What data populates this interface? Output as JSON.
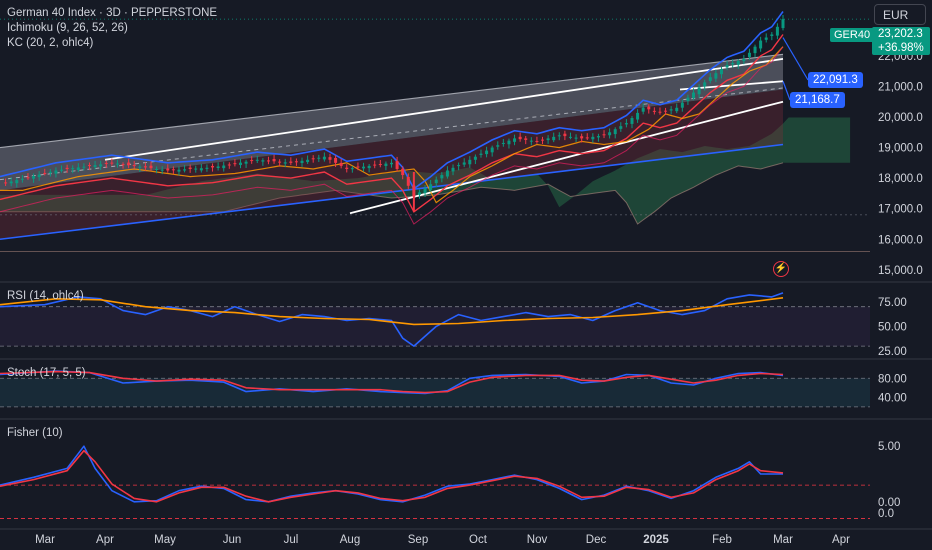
{
  "header": {
    "title": "German 40 Index · 3D · PEPPERSTONE",
    "indicators": [
      "Ichimoku (9, 26, 52, 26)",
      "KC (20, 2, ohlc4)"
    ]
  },
  "currency": "EUR",
  "price_tags": {
    "symbol": "GER40",
    "last_price": "23,202.3",
    "change_pct": "+36.98%",
    "level_upper": "22,091.3",
    "level_lower": "21,168.7"
  },
  "colors": {
    "bg": "#161a25",
    "up": "#089981",
    "down": "#f23645",
    "blue": "#2962ff",
    "orange": "#ff9800",
    "rsi": "#2962ff",
    "grid": "#2a2e39",
    "text": "#d1d4dc"
  },
  "chart_data": [
    {
      "type": "candlestick",
      "name": "main",
      "x_labels": [
        "Mar",
        "Apr",
        "May",
        "Jun",
        "Jul",
        "Aug",
        "Sep",
        "Oct",
        "Nov",
        "Dec",
        "2025",
        "Feb",
        "Mar",
        "Apr"
      ],
      "y_ticks": [
        15000,
        16000,
        17000,
        18000,
        19000,
        20000,
        21000,
        22000
      ],
      "y_tick_labels": [
        "15,000.0",
        "16,000.0",
        "17,000.0",
        "18,000.0",
        "19,000.0",
        "20,000.0",
        "21,000.0",
        "22,000.0"
      ],
      "ylim": [
        14700,
        23500
      ],
      "close_path": [
        [
          0,
          17800
        ],
        [
          10,
          18250
        ],
        [
          20,
          18500
        ],
        [
          30,
          18250
        ],
        [
          38,
          18350
        ],
        [
          46,
          18600
        ],
        [
          52,
          18500
        ],
        [
          58,
          18700
        ],
        [
          62,
          18300
        ],
        [
          66,
          18400
        ],
        [
          70,
          18500
        ],
        [
          72,
          18100
        ],
        [
          74,
          17400
        ],
        [
          77,
          17800
        ],
        [
          80,
          18250
        ],
        [
          84,
          18600
        ],
        [
          88,
          19000
        ],
        [
          92,
          19300
        ],
        [
          96,
          19200
        ],
        [
          100,
          19400
        ],
        [
          104,
          19300
        ],
        [
          108,
          19400
        ],
        [
          112,
          19800
        ],
        [
          115,
          20300
        ],
        [
          118,
          20150
        ],
        [
          121,
          20300
        ],
        [
          124,
          20800
        ],
        [
          127,
          21300
        ],
        [
          130,
          21700
        ],
        [
          133,
          21900
        ],
        [
          136,
          22500
        ],
        [
          138,
          22700
        ],
        [
          140,
          23200
        ]
      ],
      "annotations": {
        "upper_level": 22091.3,
        "lower_level": 21168.7,
        "last": 23202.3
      }
    },
    {
      "type": "line",
      "name": "RSI (14, ohlc4)",
      "y_ticks": [
        25,
        50,
        75
      ],
      "y_tick_labels": [
        "25.00",
        "50.00",
        "75.00"
      ],
      "ylim": [
        22,
        90
      ],
      "levels": [
        30,
        70
      ],
      "series": [
        {
          "name": "RSI",
          "color": "#2962ff",
          "points": [
            [
              0,
              70
            ],
            [
              8,
              72
            ],
            [
              14,
              80
            ],
            [
              18,
              78
            ],
            [
              22,
              66
            ],
            [
              26,
              62
            ],
            [
              30,
              70
            ],
            [
              34,
              66
            ],
            [
              38,
              60
            ],
            [
              42,
              70
            ],
            [
              46,
              62
            ],
            [
              50,
              55
            ],
            [
              54,
              62
            ],
            [
              58,
              60
            ],
            [
              62,
              56
            ],
            [
              66,
              58
            ],
            [
              70,
              56
            ],
            [
              72,
              38
            ],
            [
              74,
              30
            ],
            [
              78,
              50
            ],
            [
              82,
              62
            ],
            [
              86,
              56
            ],
            [
              90,
              60
            ],
            [
              94,
              64
            ],
            [
              98,
              60
            ],
            [
              102,
              62
            ],
            [
              106,
              56
            ],
            [
              110,
              66
            ],
            [
              114,
              74
            ],
            [
              118,
              66
            ],
            [
              122,
              62
            ],
            [
              126,
              66
            ],
            [
              130,
              78
            ],
            [
              134,
              82
            ],
            [
              138,
              80
            ],
            [
              140,
              84
            ]
          ]
        },
        {
          "name": "RSI MA",
          "color": "#ff9800",
          "points": [
            [
              0,
              72
            ],
            [
              10,
              78
            ],
            [
              18,
              77
            ],
            [
              26,
              70
            ],
            [
              34,
              66
            ],
            [
              42,
              64
            ],
            [
              50,
              60
            ],
            [
              58,
              58
            ],
            [
              66,
              57
            ],
            [
              74,
              52
            ],
            [
              82,
              53
            ],
            [
              90,
              56
            ],
            [
              98,
              58
            ],
            [
              106,
              59
            ],
            [
              114,
              62
            ],
            [
              122,
              66
            ],
            [
              130,
              72
            ],
            [
              140,
              79
            ]
          ]
        }
      ]
    },
    {
      "type": "line",
      "name": "Stoch (17, 5, 5)",
      "y_ticks": [
        40,
        80
      ],
      "y_tick_labels": [
        "40.00",
        "80.00"
      ],
      "ylim": [
        5,
        110
      ],
      "levels": [
        20,
        80
      ],
      "series": [
        {
          "name": "%K",
          "color": "#2962ff",
          "points": [
            [
              0,
              88
            ],
            [
              10,
              95
            ],
            [
              16,
              92
            ],
            [
              22,
              70
            ],
            [
              28,
              74
            ],
            [
              34,
              76
            ],
            [
              40,
              72
            ],
            [
              44,
              52
            ],
            [
              50,
              58
            ],
            [
              56,
              52
            ],
            [
              62,
              58
            ],
            [
              68,
              52
            ],
            [
              72,
              50
            ],
            [
              76,
              48
            ],
            [
              80,
              54
            ],
            [
              84,
              80
            ],
            [
              88,
              86
            ],
            [
              94,
              88
            ],
            [
              100,
              84
            ],
            [
              104,
              70
            ],
            [
              108,
              74
            ],
            [
              112,
              88
            ],
            [
              116,
              86
            ],
            [
              120,
              70
            ],
            [
              124,
              66
            ],
            [
              128,
              80
            ],
            [
              132,
              90
            ],
            [
              136,
              92
            ],
            [
              140,
              86
            ]
          ]
        },
        {
          "name": "%D",
          "color": "#f23645",
          "points": [
            [
              0,
              90
            ],
            [
              10,
              94
            ],
            [
              16,
              92
            ],
            [
              22,
              80
            ],
            [
              28,
              74
            ],
            [
              34,
              78
            ],
            [
              40,
              76
            ],
            [
              44,
              60
            ],
            [
              50,
              56
            ],
            [
              56,
              56
            ],
            [
              62,
              56
            ],
            [
              68,
              56
            ],
            [
              72,
              52
            ],
            [
              76,
              50
            ],
            [
              80,
              52
            ],
            [
              84,
              72
            ],
            [
              88,
              82
            ],
            [
              94,
              86
            ],
            [
              100,
              86
            ],
            [
              104,
              76
            ],
            [
              108,
              74
            ],
            [
              112,
              82
            ],
            [
              116,
              86
            ],
            [
              120,
              78
            ],
            [
              124,
              70
            ],
            [
              128,
              76
            ],
            [
              132,
              86
            ],
            [
              136,
              90
            ],
            [
              140,
              88
            ]
          ]
        }
      ]
    },
    {
      "type": "line",
      "name": "Fisher (10)",
      "y_ticks": [
        0,
        5
      ],
      "y_tick_labels": [
        "0.00",
        "5.00"
      ],
      "ylim": [
        -2,
        7
      ],
      "levels": [
        1.5,
        -1.5
      ],
      "series": [
        {
          "name": "Fisher",
          "color": "#2962ff",
          "points": [
            [
              0,
              1.5
            ],
            [
              6,
              2.2
            ],
            [
              12,
              3.0
            ],
            [
              15,
              5.0
            ],
            [
              17,
              3.0
            ],
            [
              20,
              1.0
            ],
            [
              24,
              0
            ],
            [
              28,
              0.1
            ],
            [
              32,
              1.0
            ],
            [
              36,
              1.4
            ],
            [
              40,
              1.2
            ],
            [
              44,
              0.2
            ],
            [
              48,
              0.0
            ],
            [
              52,
              0.5
            ],
            [
              56,
              0.8
            ],
            [
              60,
              1.0
            ],
            [
              64,
              0.7
            ],
            [
              68,
              0.2
            ],
            [
              72,
              0.0
            ],
            [
              76,
              0.6
            ],
            [
              80,
              1.4
            ],
            [
              84,
              1.6
            ],
            [
              88,
              2.0
            ],
            [
              92,
              2.4
            ],
            [
              96,
              2.0
            ],
            [
              100,
              1.2
            ],
            [
              104,
              0.2
            ],
            [
              108,
              0.6
            ],
            [
              112,
              1.4
            ],
            [
              116,
              1.0
            ],
            [
              120,
              0.3
            ],
            [
              124,
              1.0
            ],
            [
              128,
              2.2
            ],
            [
              132,
              3.0
            ],
            [
              134,
              3.6
            ],
            [
              136,
              2.5
            ],
            [
              140,
              2.5
            ]
          ]
        },
        {
          "name": "Trigger",
          "color": "#f23645",
          "points": [
            [
              0,
              1.4
            ],
            [
              6,
              2.0
            ],
            [
              12,
              2.8
            ],
            [
              15,
              4.6
            ],
            [
              17,
              3.6
            ],
            [
              20,
              1.6
            ],
            [
              24,
              0.3
            ],
            [
              28,
              0.0
            ],
            [
              32,
              0.8
            ],
            [
              36,
              1.3
            ],
            [
              40,
              1.3
            ],
            [
              44,
              0.5
            ],
            [
              48,
              0.0
            ],
            [
              52,
              0.4
            ],
            [
              56,
              0.7
            ],
            [
              60,
              1.0
            ],
            [
              64,
              0.8
            ],
            [
              68,
              0.3
            ],
            [
              72,
              0.1
            ],
            [
              76,
              0.4
            ],
            [
              80,
              1.2
            ],
            [
              84,
              1.5
            ],
            [
              88,
              1.9
            ],
            [
              92,
              2.3
            ],
            [
              96,
              2.1
            ],
            [
              100,
              1.4
            ],
            [
              104,
              0.4
            ],
            [
              108,
              0.5
            ],
            [
              112,
              1.3
            ],
            [
              116,
              1.1
            ],
            [
              120,
              0.4
            ],
            [
              124,
              0.8
            ],
            [
              128,
              2.0
            ],
            [
              132,
              2.8
            ],
            [
              134,
              3.4
            ],
            [
              136,
              2.8
            ],
            [
              140,
              2.6
            ]
          ]
        }
      ]
    }
  ],
  "fisher_extra_tick": "0.0"
}
